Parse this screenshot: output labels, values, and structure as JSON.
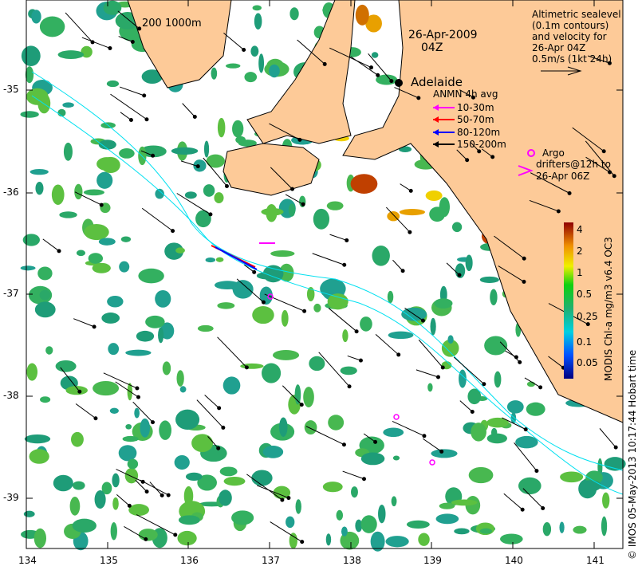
{
  "map": {
    "date": "26-Apr-2009",
    "time": "04Z",
    "scale_label": "200  1000m",
    "city": "Adelaide",
    "altimetry_legend": [
      "Altimetric sealevel",
      "(0.1m contours)",
      "and velocity for",
      "26-Apr 04Z",
      "0.5m/s (1kt 24h)"
    ],
    "anmn_legend": {
      "title": "ANMN 4h avg",
      "items": [
        {
          "label": "10-30m",
          "color": "#ff00ff"
        },
        {
          "label": "50-70m",
          "color": "#ff0000"
        },
        {
          "label": "80-120m",
          "color": "#0000ff"
        },
        {
          "label": "150-200m",
          "color": "#000000"
        }
      ]
    },
    "argo_label": "Argo",
    "drifters_label": [
      "drifters@12h to",
      "26-Apr 06Z"
    ],
    "colorbar": {
      "title": "MODIS Chl-a mg/m3 v6.4 OC3",
      "ticks": [
        "4",
        "2",
        "1",
        "0.5",
        "0.25",
        "0.1",
        "0.05"
      ]
    },
    "credit": "© IMOS 05-May-2013 10:17:44 Hobart time",
    "x_ticks": [
      "134",
      "135",
      "136",
      "137",
      "138",
      "139",
      "140",
      "141"
    ],
    "y_ticks": [
      "-35",
      "-36",
      "-37",
      "-38",
      "-39"
    ],
    "colors": {
      "land": "#fdca98",
      "sea_contour": "#00e0f0",
      "data_green": "#33b060"
    }
  }
}
